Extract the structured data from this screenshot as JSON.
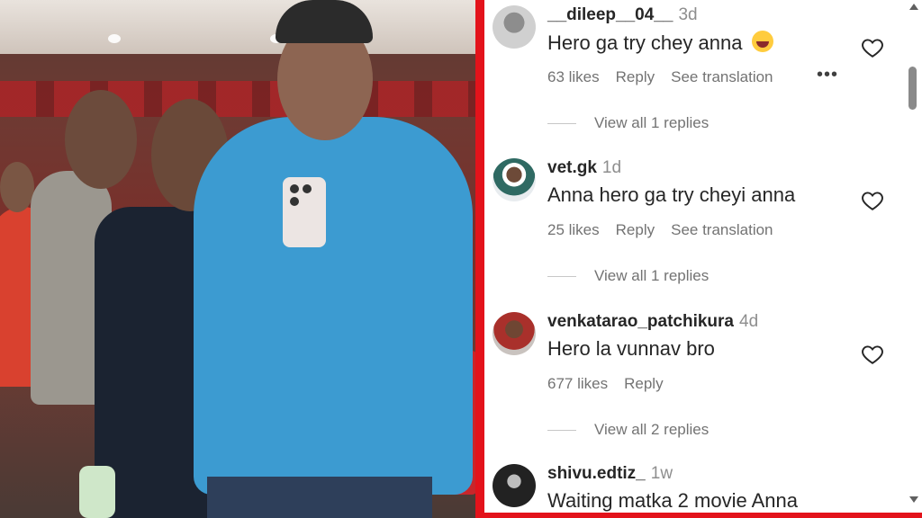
{
  "comments": [
    {
      "username": "__dileep__04__",
      "time": "3d",
      "text": "Hero ga try chey anna",
      "emoji": "laughing-emoji",
      "likes": "63 likes",
      "reply": "Reply",
      "translate": "See translation",
      "more": "•••",
      "replies": "View all 1 replies"
    },
    {
      "username": "vet.gk",
      "time": "1d",
      "text": "Anna hero ga try cheyi anna",
      "likes": "25 likes",
      "reply": "Reply",
      "translate": "See translation",
      "replies": "View all 1 replies"
    },
    {
      "username": "venkatarao_patchikura",
      "time": "4d",
      "text": "Hero la vunnav bro",
      "likes": "677 likes",
      "reply": "Reply",
      "replies": "View all 2 replies"
    },
    {
      "username": "shivu.edtiz_",
      "time": "1w",
      "text": "Waiting matka 2 movie Anna"
    }
  ],
  "colors": {
    "divider": "#e3131b",
    "text": "#262626",
    "muted": "#737373"
  },
  "icons": {
    "like": "heart-outline-icon",
    "more": "more-horizontal-icon"
  }
}
